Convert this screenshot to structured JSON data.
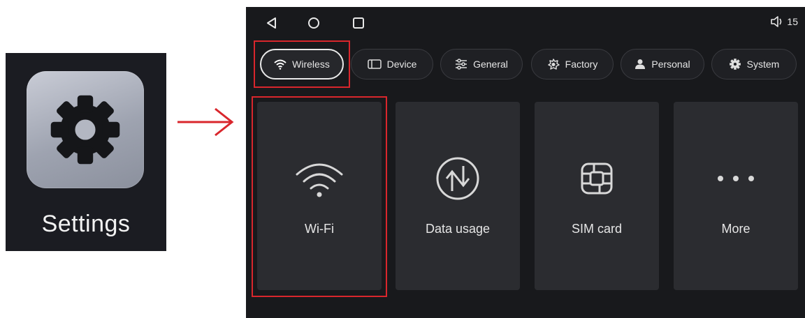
{
  "app_tile": {
    "label": "Settings",
    "icon": "gear-icon"
  },
  "statusbar": {
    "nav": [
      "back-icon",
      "home-icon",
      "recents-icon"
    ],
    "volume_icon": "volume-icon",
    "volume_value": "15"
  },
  "tabs": [
    {
      "label": "Wireless",
      "icon": "wifi-icon",
      "active": true
    },
    {
      "label": "Device",
      "icon": "device-icon",
      "active": false
    },
    {
      "label": "General",
      "icon": "sliders-icon",
      "active": false
    },
    {
      "label": "Factory",
      "icon": "factory-icon",
      "active": false
    },
    {
      "label": "Personal",
      "icon": "person-icon",
      "active": false
    },
    {
      "label": "System",
      "icon": "system-gear-icon",
      "active": false
    }
  ],
  "tiles": [
    {
      "label": "Wi-Fi",
      "icon": "wifi-icon"
    },
    {
      "label": "Data usage",
      "icon": "data-usage-icon"
    },
    {
      "label": "SIM card",
      "icon": "sim-card-icon"
    },
    {
      "label": "More",
      "icon": "more-dots-icon"
    }
  ],
  "colors": {
    "highlight": "#d9262c",
    "screen_bg": "#18191c",
    "tile_bg": "#2b2c30"
  }
}
